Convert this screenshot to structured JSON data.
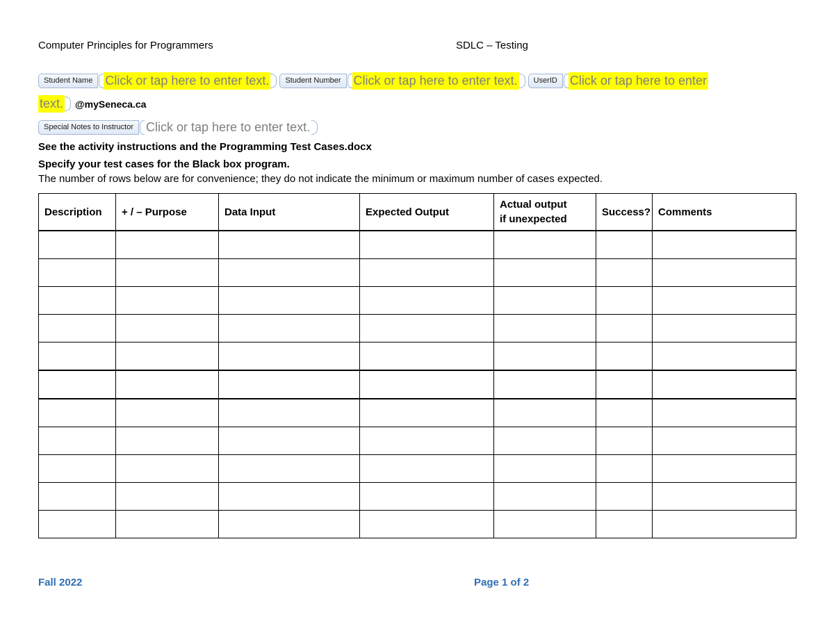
{
  "header": {
    "left": "Computer Principles for Programmers",
    "right": "SDLC – Testing"
  },
  "form": {
    "student_name_tag": "Student Name",
    "student_name_placeholder": "Click or tap here to enter text.",
    "student_number_tag": "Student Number",
    "student_number_placeholder": "Click or tap here to enter text.",
    "userid_tag": "UserID",
    "userid_placeholder_line1": "Click or tap here to enter",
    "userid_placeholder_line2": "text.",
    "email_suffix": "@mySeneca.ca",
    "notes_tag": "Special Notes to Instructor",
    "notes_placeholder": "Click or tap here to enter text."
  },
  "instructions": {
    "line1": "See the activity instructions and the Programming Test Cases.docx",
    "line2": "Specify your test cases for the Black box program.",
    "line3": "The number of rows below are for convenience; they do not indicate the minimum or maximum number of cases expected."
  },
  "table": {
    "columns": {
      "description": "Description",
      "purpose": "+ / – Purpose",
      "data_input": "Data Input",
      "expected_output": "Expected Output",
      "actual_output_line1": "Actual output",
      "actual_output_line2": "if unexpected",
      "success": "Success?",
      "comments": "Comments"
    },
    "row_count": 11
  },
  "footer": {
    "left": "Fall 2022",
    "right": "Page 1 of 2"
  }
}
